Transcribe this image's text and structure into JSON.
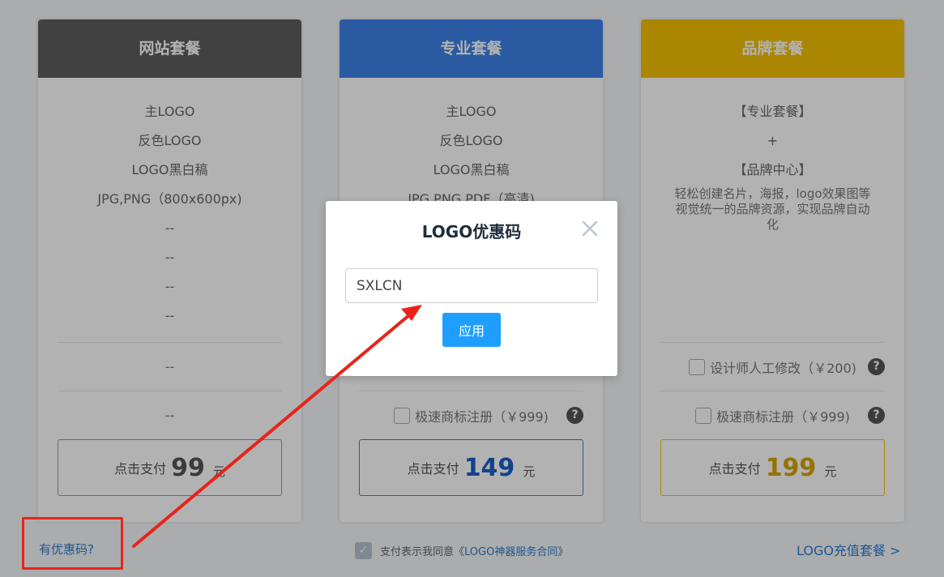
{
  "plans": [
    {
      "title": "网站套餐",
      "features": [
        "主LOGO",
        "反色LOGO",
        "LOGO黑白稿",
        "JPG,PNG（800x600px)",
        "--",
        "--",
        "--",
        "--"
      ],
      "row_a": "--",
      "row_b": "--",
      "pay_label": "点击支付",
      "price": "99",
      "unit": "元"
    },
    {
      "title": "专业套餐",
      "features": [
        "主LOGO",
        "反色LOGO",
        "LOGO黑白稿",
        "JPG,PNG,PDF（高清)"
      ],
      "row_b": "极速商标注册（￥999)",
      "pay_label": "点击支付",
      "price": "149",
      "unit": "元"
    },
    {
      "title": "品牌套餐",
      "features": [
        "【专业套餐】",
        "+",
        "【品牌中心】"
      ],
      "description": "轻松创建名片，海报，logo效果图等视觉统一的品牌资源，实现品牌自动化",
      "row_a": "设计师人工修改（￥200)",
      "row_b": "极速商标注册（￥999)",
      "pay_label": "点击支付",
      "price": "199",
      "unit": "元"
    }
  ],
  "footer": {
    "coupon_link": "有优惠码?",
    "agree_text": "支付表示我同意《",
    "agree_link": "LOGO神器服务合同",
    "agree_end": "》",
    "recharge_link": "LOGO充值套餐 >"
  },
  "modal": {
    "title": "LOGO优惠码",
    "input_value": "SXLCN",
    "apply_label": "应用"
  },
  "colors": {
    "plan_1": "#5d5d5d",
    "plan_2": "#3b82e8",
    "plan_3": "#f5c000",
    "link": "#2f7fd1",
    "apply_button": "#1e9fff",
    "annotation": "#e8231a"
  },
  "icons": {
    "close": "close-icon",
    "help": "question-circle-icon",
    "check": "check-icon"
  }
}
